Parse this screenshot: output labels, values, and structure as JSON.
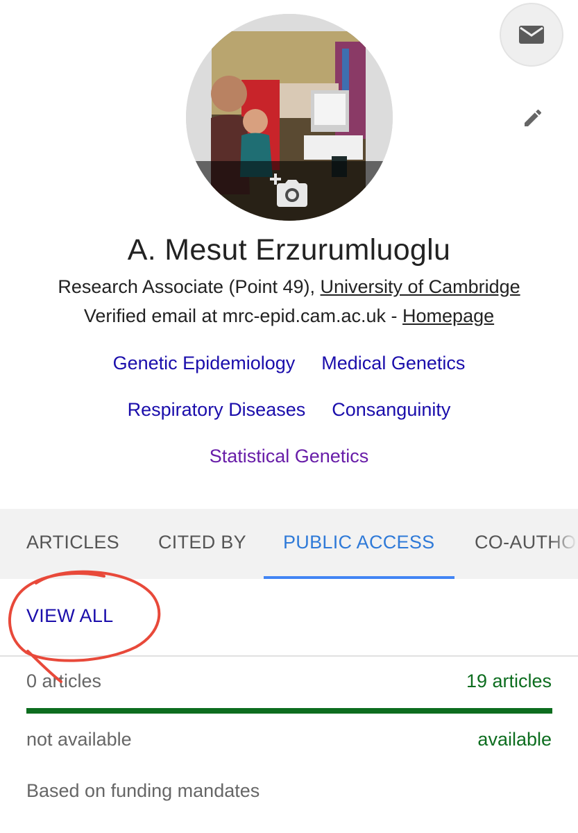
{
  "profile": {
    "name": "A. Mesut Erzurumluoglu",
    "affiliation_prefix": "Research Associate (Point 49), ",
    "affiliation_link": "University of Cambridge",
    "email_prefix": "Verified email at mrc-epid.cam.ac.uk - ",
    "homepage_link": "Homepage",
    "interests": [
      "Genetic Epidemiology",
      "Medical Genetics",
      "Respiratory Diseases",
      "Consanguinity",
      "Statistical Genetics"
    ]
  },
  "icons": {
    "email": "mail-icon",
    "edit": "pencil-icon",
    "camera": "add-photo-icon"
  },
  "tabs": [
    "ARTICLES",
    "CITED BY",
    "PUBLIC ACCESS",
    "CO-AUTHORS"
  ],
  "active_tab": "PUBLIC ACCESS",
  "public_access": {
    "view_all": "VIEW ALL",
    "not_available_count": "0 articles",
    "available_count": "19 articles",
    "available_fraction": 1.0,
    "not_available_label": "not available",
    "available_label": "available",
    "note": "Based on funding mandates"
  },
  "colors": {
    "link": "#1a0dab",
    "visited_link": "#681da8",
    "active_tab": "#2f7ad8",
    "tab_underline": "#4285f4",
    "available_green": "#0d6d1f",
    "annotation_red": "#e8493a"
  }
}
